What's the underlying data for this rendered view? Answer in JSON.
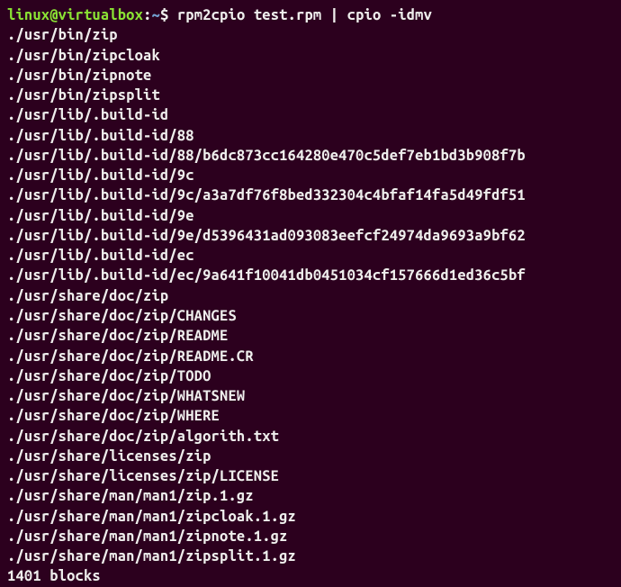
{
  "prompt": {
    "user": "linux",
    "at": "@",
    "host": "virtualbox",
    "colon": ":",
    "path": "~",
    "dollar": "$ ",
    "command": "rpm2cpio test.rpm | cpio -idmv"
  },
  "output_lines": [
    "./usr/bin/zip",
    "./usr/bin/zipcloak",
    "./usr/bin/zipnote",
    "./usr/bin/zipsplit",
    "./usr/lib/.build-id",
    "./usr/lib/.build-id/88",
    "./usr/lib/.build-id/88/b6dc873cc164280e470c5def7eb1bd3b908f7b",
    "./usr/lib/.build-id/9c",
    "./usr/lib/.build-id/9c/a3a7df76f8bed332304c4bfaf14fa5d49fdf51",
    "./usr/lib/.build-id/9e",
    "./usr/lib/.build-id/9e/d5396431ad093083eefcf24974da9693a9bf62",
    "./usr/lib/.build-id/ec",
    "./usr/lib/.build-id/ec/9a641f10041db0451034cf157666d1ed36c5bf",
    "./usr/share/doc/zip",
    "./usr/share/doc/zip/CHANGES",
    "./usr/share/doc/zip/README",
    "./usr/share/doc/zip/README.CR",
    "./usr/share/doc/zip/TODO",
    "./usr/share/doc/zip/WHATSNEW",
    "./usr/share/doc/zip/WHERE",
    "./usr/share/doc/zip/algorith.txt",
    "./usr/share/licenses/zip",
    "./usr/share/licenses/zip/LICENSE",
    "./usr/share/man/man1/zip.1.gz",
    "./usr/share/man/man1/zipcloak.1.gz",
    "./usr/share/man/man1/zipnote.1.gz",
    "./usr/share/man/man1/zipsplit.1.gz",
    "1401 blocks"
  ]
}
